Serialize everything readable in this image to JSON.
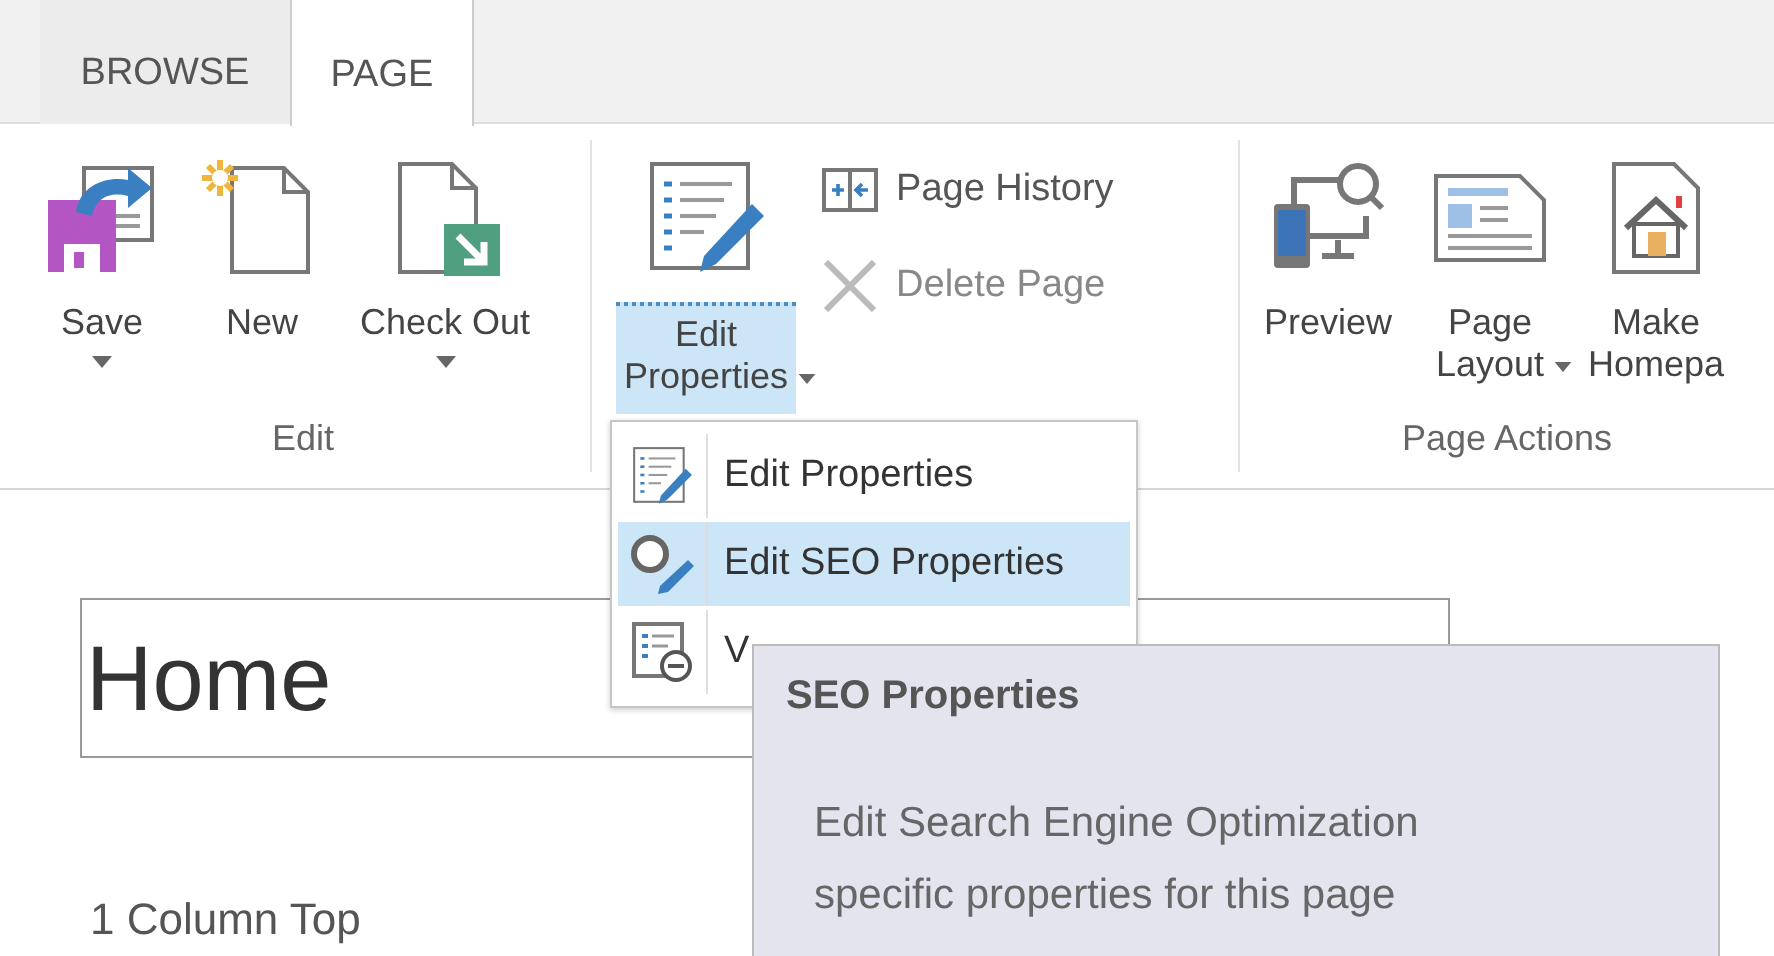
{
  "tabs": [
    {
      "label": "BROWSE",
      "selected": false
    },
    {
      "label": "PAGE",
      "selected": true
    }
  ],
  "ribbon": {
    "groups": [
      {
        "label": "Edit",
        "large_buttons": [
          {
            "label": "Save",
            "kind": "save",
            "dropdown": true,
            "selected": false
          },
          {
            "label": "New",
            "kind": "new",
            "dropdown": false,
            "selected": false
          },
          {
            "label": "Check Out",
            "kind": "checkout",
            "dropdown": true,
            "selected": false
          }
        ]
      },
      {
        "large_buttons": [
          {
            "label": "Edit Properties",
            "kind": "properties",
            "dropdown": true,
            "selected": true
          }
        ],
        "small_buttons": [
          {
            "label": "Page History",
            "kind": "history",
            "disabled": false
          },
          {
            "label": "Delete Page",
            "kind": "delete",
            "disabled": true
          }
        ]
      },
      {
        "label": "Page Actions",
        "large_buttons": [
          {
            "label": "Preview",
            "kind": "preview",
            "dropdown": false,
            "selected": false
          },
          {
            "label": "Page Layout",
            "kind": "layout",
            "dropdown": true,
            "selected": false
          },
          {
            "label": "Make Homepa",
            "kind": "homepage",
            "dropdown": false,
            "selected": false
          }
        ]
      }
    ]
  },
  "menu": {
    "items": [
      {
        "label": "Edit Properties",
        "kind": "properties",
        "selected": false
      },
      {
        "label": "Edit SEO Properties",
        "kind": "seo",
        "selected": true
      },
      {
        "label": "V",
        "kind": "view",
        "selected": false
      }
    ]
  },
  "tooltip": {
    "title": "SEO Properties",
    "description": "Edit Search Engine Optimization specific properties for this page"
  },
  "page": {
    "title_field": {
      "value": "Home"
    },
    "zone_label": "1 Column Top"
  }
}
